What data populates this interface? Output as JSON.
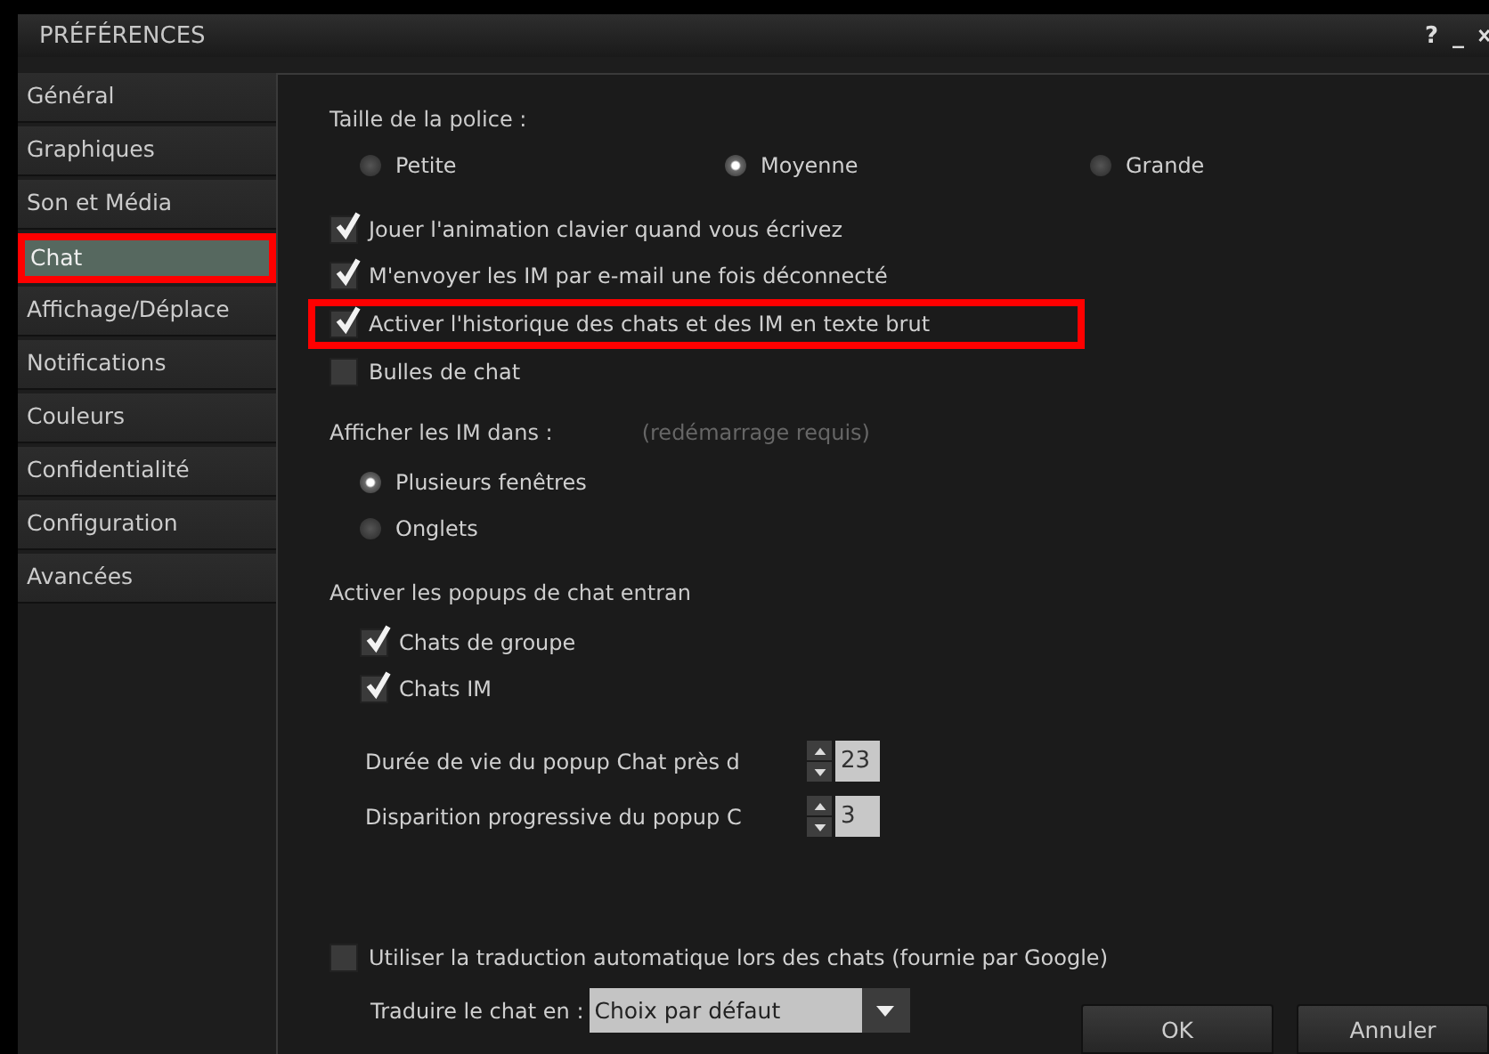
{
  "window": {
    "title": "PRÉFÉRENCES",
    "controls": [
      "?",
      "_"
    ]
  },
  "sidebar": {
    "items": [
      {
        "label": "Général",
        "selected": false,
        "highlighted": false
      },
      {
        "label": "Graphiques",
        "selected": false,
        "highlighted": false
      },
      {
        "label": "Son et Média",
        "selected": false,
        "highlighted": false
      },
      {
        "label": "Chat",
        "selected": true,
        "highlighted": true
      },
      {
        "label": "Affichage/Déplace",
        "selected": false,
        "highlighted": false
      },
      {
        "label": "Notifications",
        "selected": false,
        "highlighted": false
      },
      {
        "label": "Couleurs",
        "selected": false,
        "highlighted": false
      },
      {
        "label": "Confidentialité",
        "selected": false,
        "highlighted": false
      },
      {
        "label": "Configuration",
        "selected": false,
        "highlighted": false
      },
      {
        "label": "Avancées",
        "selected": false,
        "highlighted": false
      }
    ]
  },
  "font_size": {
    "label": "Taille de la police :",
    "options": [
      {
        "label": "Petite",
        "selected": false
      },
      {
        "label": "Moyenne",
        "selected": true
      },
      {
        "label": "Grande",
        "selected": false
      }
    ]
  },
  "checkboxes": [
    {
      "label": "Jouer l'animation clavier quand vous écrivez",
      "checked": true,
      "highlighted": false
    },
    {
      "label": "M'envoyer les IM par e-mail une fois déconnecté",
      "checked": true,
      "highlighted": false
    },
    {
      "label": "Activer l'historique des chats et des IM en texte brut",
      "checked": true,
      "highlighted": true
    },
    {
      "label": "Bulles de chat",
      "checked": false,
      "highlighted": false
    }
  ],
  "im_display": {
    "label": "Afficher les IM dans :",
    "hint": "(redémarrage requis)",
    "options": [
      {
        "label": "Plusieurs fenêtres",
        "selected": true
      },
      {
        "label": "Onglets",
        "selected": false
      }
    ]
  },
  "popups": {
    "label": "Activer les popups de chat entran",
    "checkboxes": [
      {
        "label": "Chats de groupe",
        "checked": true
      },
      {
        "label": "Chats IM",
        "checked": true
      }
    ],
    "spinners": [
      {
        "label": "Durée de vie du popup Chat près d",
        "value": "23"
      },
      {
        "label": "Disparition progressive du popup C",
        "value": "3"
      }
    ]
  },
  "translate": {
    "checkbox": {
      "label": "Utiliser la traduction automatique lors des chats (fournie par Google)",
      "checked": false
    },
    "label": "Traduire le chat en :",
    "dropdown": "Choix par défaut"
  },
  "buttons": [
    "OK",
    "Annuler"
  ]
}
